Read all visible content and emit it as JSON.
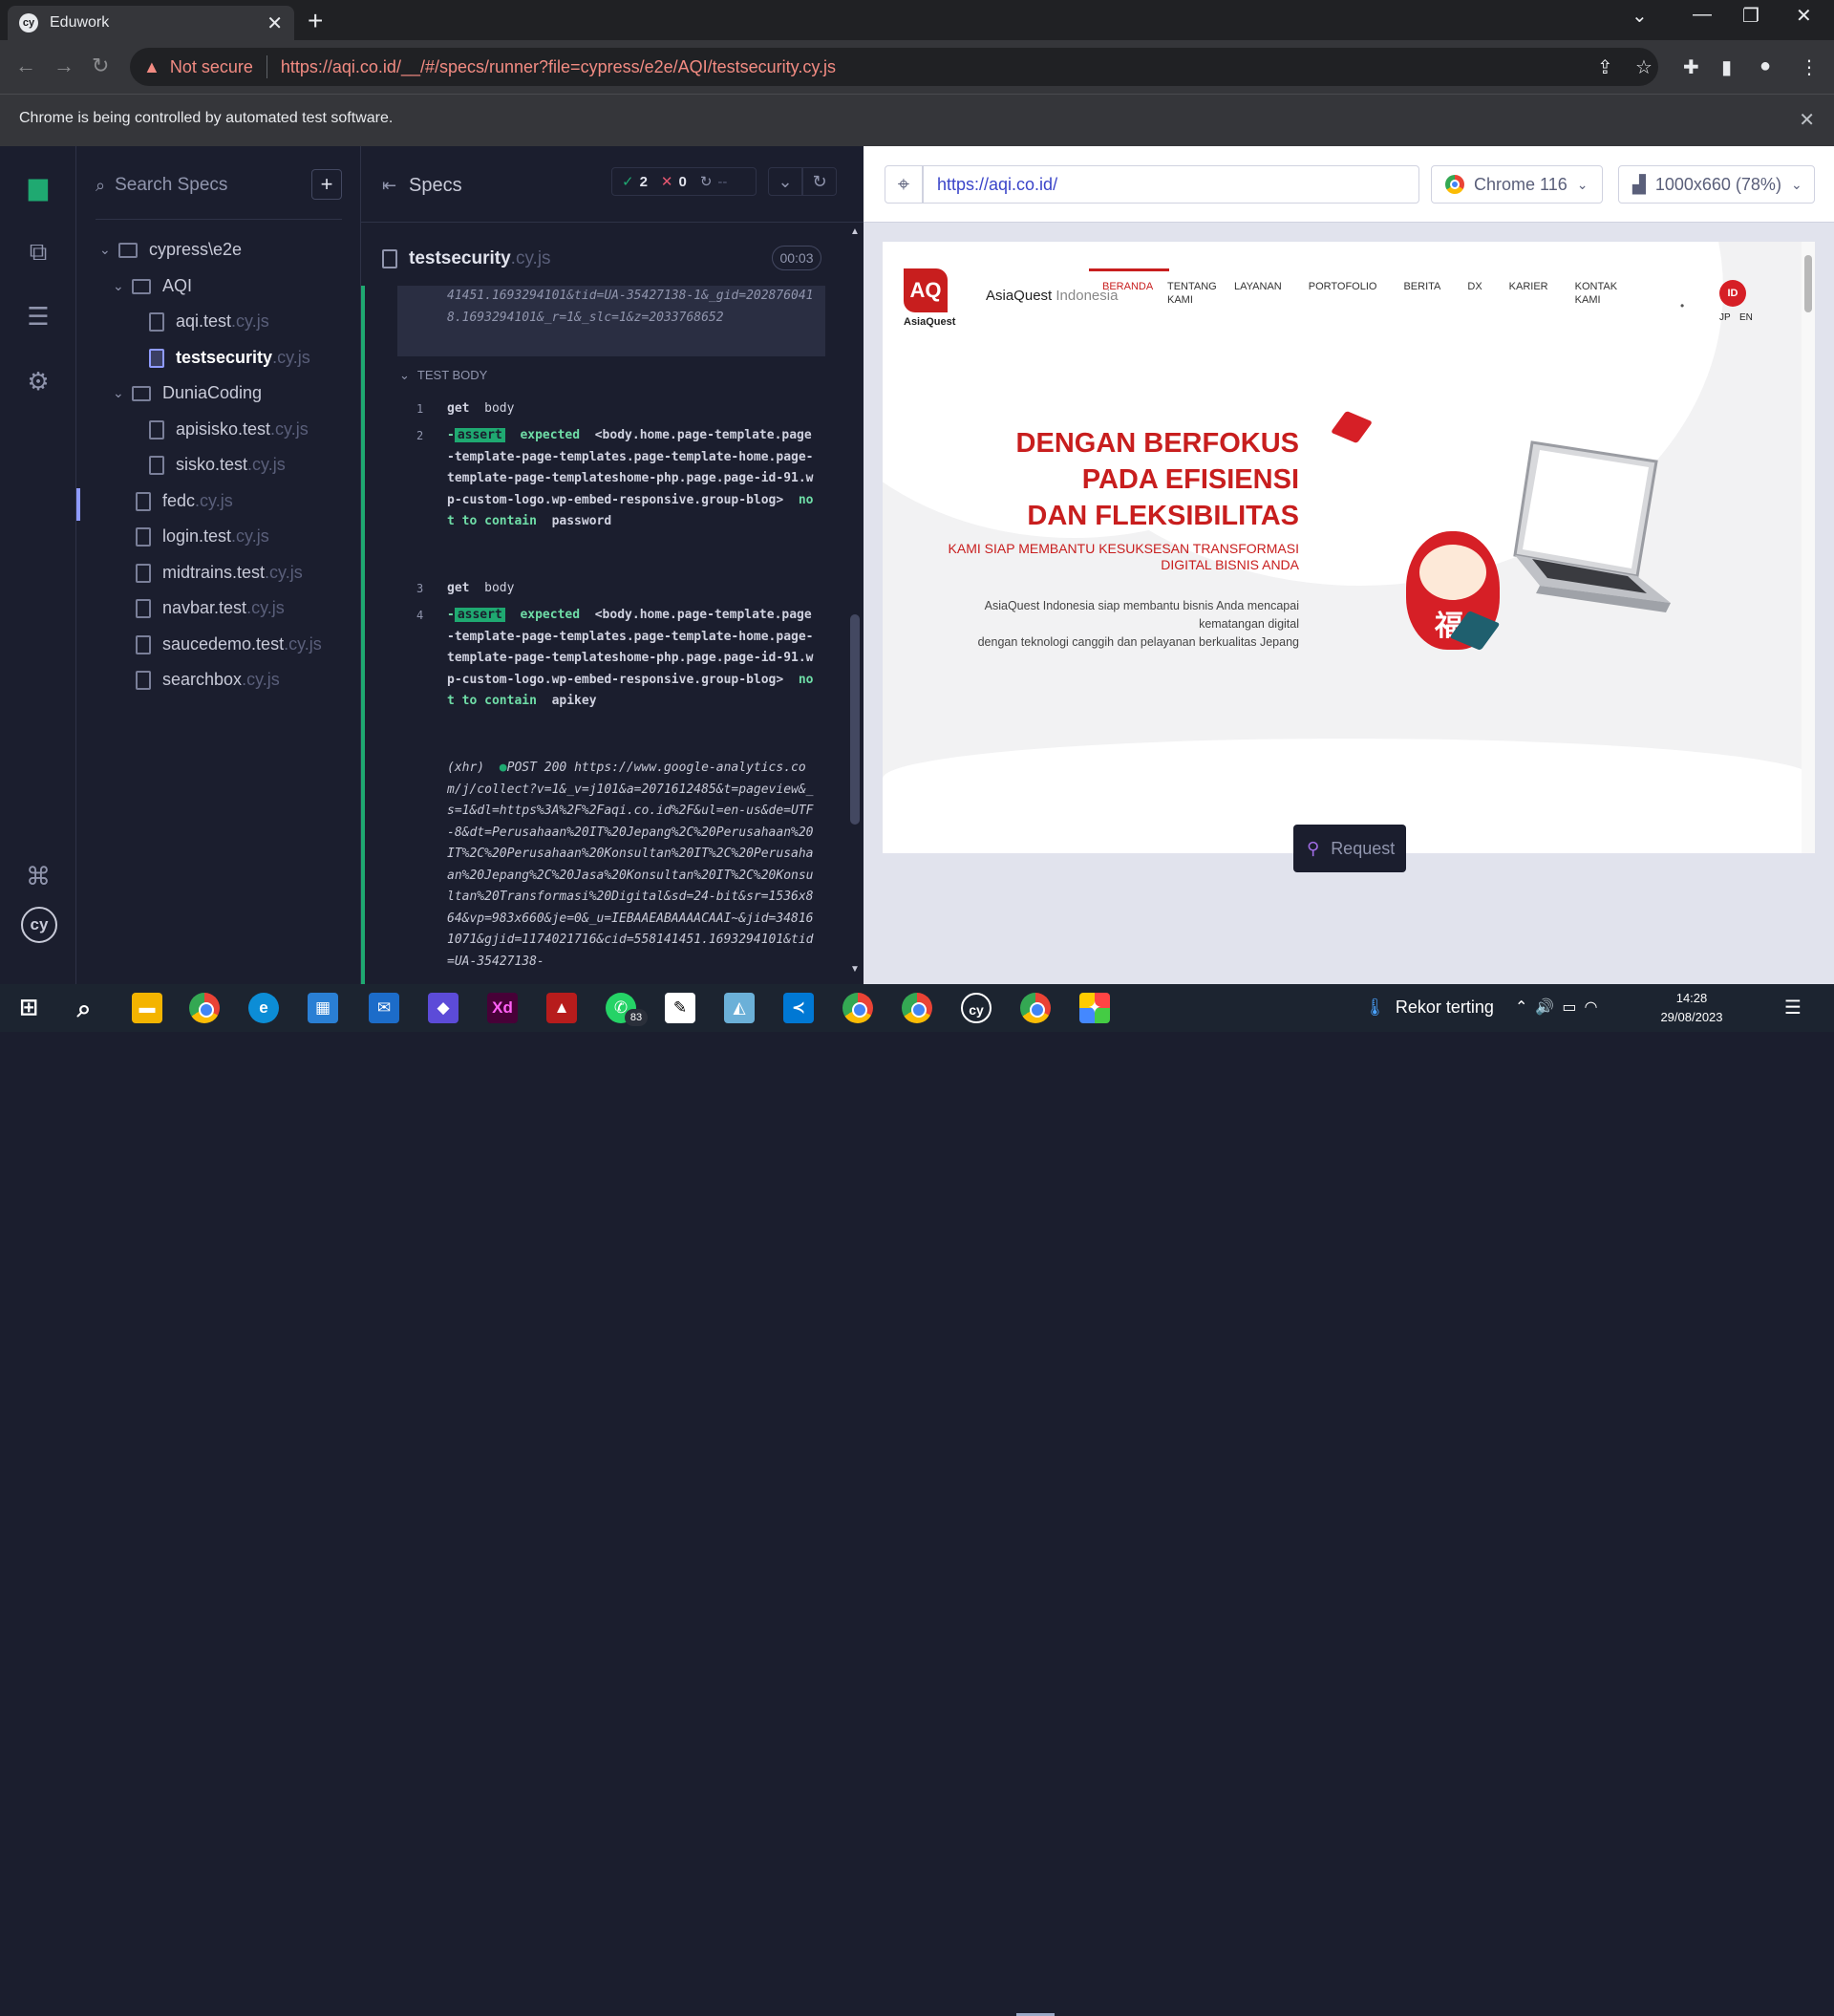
{
  "browser": {
    "tab_title": "Eduwork",
    "favicon_text": "cy",
    "not_secure": "Not secure",
    "url": "https://aqi.co.id/__/#/specs/runner?file=cypress/e2e/AQI/testsecurity.cy.js",
    "infobar": "Chrome is being controlled by automated test software."
  },
  "sidebar": {
    "search_placeholder": "Search Specs",
    "tree": [
      {
        "label": "cypress\\e2e",
        "type": "folder"
      },
      {
        "label": "AQI",
        "type": "folder"
      },
      {
        "name": "aqi.test",
        "ext": ".cy.js",
        "type": "file"
      },
      {
        "name": "testsecurity",
        "ext": ".cy.js",
        "type": "file",
        "active": true
      },
      {
        "label": "DuniaCoding",
        "type": "folder"
      },
      {
        "name": "apisisko.test",
        "ext": ".cy.js",
        "type": "file"
      },
      {
        "name": "sisko.test",
        "ext": ".cy.js",
        "type": "file"
      },
      {
        "name": "fedc",
        "ext": ".cy.js",
        "type": "file"
      },
      {
        "name": "login.test",
        "ext": ".cy.js",
        "type": "file"
      },
      {
        "name": "midtrains.test",
        "ext": ".cy.js",
        "type": "file"
      },
      {
        "name": "navbar.test",
        "ext": ".cy.js",
        "type": "file"
      },
      {
        "name": "saucedemo.test",
        "ext": ".cy.js",
        "type": "file"
      },
      {
        "name": "searchbox",
        "ext": ".cy.js",
        "type": "file"
      }
    ]
  },
  "reporter": {
    "title": "Specs",
    "passed": "2",
    "failed": "0",
    "pending": "--",
    "spec_name": "testsecurity",
    "spec_ext": ".cy.js",
    "duration": "00:03",
    "prev_log": "41451.1693294101&tid=UA-35427138-1&_gid=2028760418.1693294101&_r=1&_slc=1&z=2033768652",
    "test_body_label": "TEST BODY",
    "commands": [
      {
        "line": "1",
        "name": "get",
        "arg": "body"
      },
      {
        "line": "2",
        "prefix": "-",
        "badge": "assert",
        "w1": "expected",
        "subject": "<body.home.page-template.page-template-page-templates.page-template-home.page-template-page-templateshome-php.page.page-id-91.wp-custom-logo.wp-embed-responsive.group-blog>",
        "w2": "not to contain",
        "value": "password"
      },
      {
        "line": "3",
        "name": "get",
        "arg": "body"
      },
      {
        "line": "4",
        "prefix": "-",
        "badge": "assert",
        "w1": "expected",
        "subject": "<body.home.page-template.page-template-page-templates.page-template-home.page-template-page-templateshome-php.page.page-id-91.wp-custom-logo.wp-embed-responsive.group-blog>",
        "w2": "not to contain",
        "value": "apikey"
      }
    ],
    "xhr": {
      "label": "(xhr)",
      "text": "POST 200 https://www.google-analytics.com/j/collect?v=1&_v=j101&a=2071612485&t=pageview&_s=1&dl=https%3A%2F%2Faqi.co.id%2F&ul=en-us&de=UTF-8&dt=Perusahaan%20IT%20Jepang%2C%20Perusahaan%20IT%2C%20Perusahaan%20Konsultan%20IT%2C%20Perusahaan%20Jepang%2C%20Jasa%20Konsultan%20IT%2C%20Konsultan%20Transformasi%20Digital&sd=24-bit&sr=1536x864&vp=983x660&je=0&_u=IEBAAEABAAAACAAI~&jid=348161071&gjid=1174021716&cid=558141451.1693294101&tid=UA-35427138-"
    }
  },
  "aut": {
    "url": "https://aqi.co.id/",
    "browser": "Chrome 116",
    "viewport": "1000x660 (78%)",
    "request_label": "Request"
  },
  "site": {
    "logo_mark": "AQ",
    "logo_text": "AsiaQuest",
    "company": "AsiaQuest",
    "company_suffix": "Indonesia",
    "menu": [
      "BERANDA",
      "TENTANG KAMI",
      "LAYANAN",
      "PORTOFOLIO",
      "BERITA",
      "DX",
      "KARIER",
      "KONTAK KAMI"
    ],
    "lang_active": "ID",
    "lang_jp": "JP",
    "lang_en": "EN",
    "hero_line1": "DENGAN BERFOKUS PADA EFISIENSI",
    "hero_line2": "DAN FLEKSIBILITAS",
    "hero_sub": "KAMI SIAP MEMBANTU KESUKSESAN TRANSFORMASI DIGITAL BISNIS ANDA",
    "hero_desc1": "AsiaQuest Indonesia siap membantu bisnis Anda mencapai kematangan digital",
    "hero_desc2": "dengan teknologi canggih dan pelayanan berkualitas Jepang",
    "daruma_char": "福"
  },
  "taskbar": {
    "weather": "Rekor terting",
    "time": "14:28",
    "date": "29/08/2023",
    "whatsapp_badge": "83"
  },
  "colors": {
    "cypress_green": "#1fa971",
    "cypress_bg": "#1b1e2e",
    "brand_red": "#c81e1e"
  }
}
